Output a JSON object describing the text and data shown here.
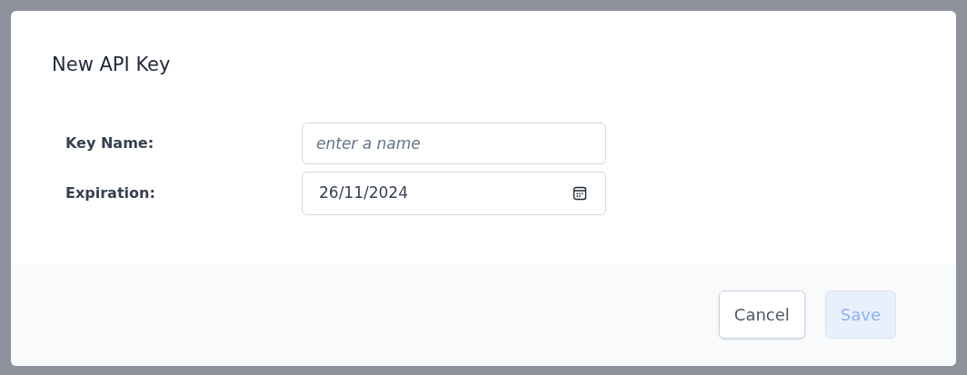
{
  "dialog": {
    "title": "New API Key"
  },
  "fields": [
    {
      "label": "Key Name:",
      "kind": "text",
      "placeholder": "enter a name"
    },
    {
      "label": "Expiration:",
      "kind": "date",
      "value": "26/11/2024"
    }
  ],
  "buttons": [
    {
      "label": "Cancel",
      "disabled": false
    },
    {
      "label": "Save",
      "disabled": true
    }
  ]
}
